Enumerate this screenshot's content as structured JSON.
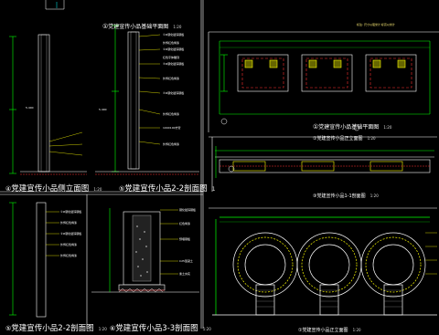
{
  "drawings": {
    "base_plan_top": {
      "num": "①",
      "title": "党建宣传小品基础平面图",
      "scale": "1:20"
    },
    "side_elevation": {
      "num": "④",
      "title": "党建宣传小品侧立面图",
      "scale": "1:20"
    },
    "section_2_2_top": {
      "num": "⑤",
      "title": "党建宣传小品2-2剖面图",
      "scale": "1"
    },
    "base_plan_right": {
      "num": "①",
      "title": "党建宣传小品基础平面图",
      "scale": "1:20"
    },
    "front_elevation_small": {
      "num": "①",
      "title": "党建宣传小品正立面图",
      "scale": "1:20"
    },
    "section_1_1": {
      "num": "③",
      "title": "党建宣传小品1-1剖面图",
      "scale": "1:20"
    },
    "section_2_2_bottom": {
      "num": "⑤",
      "title": "党建宣传小品2-2剖面图",
      "scale": "1:20"
    },
    "section_3_3": {
      "num": "⑥",
      "title": "党建宣传小品3-3剖面图",
      "scale": "1:20"
    },
    "front_elevation_main": {
      "num": "①",
      "title": "党建宣传小品正立面图",
      "scale": "1:20"
    }
  },
  "note_top_right": "标注: 尺寸以毫米计 标高以米计",
  "elev_marks": {
    "a": "5.400",
    "b": "5.400"
  },
  "colors": {
    "background": "#000000",
    "line": "#ffffff",
    "accent": "#ffff00",
    "cyan": "#00ffff",
    "green": "#00ff00",
    "red": "#ff3030"
  }
}
